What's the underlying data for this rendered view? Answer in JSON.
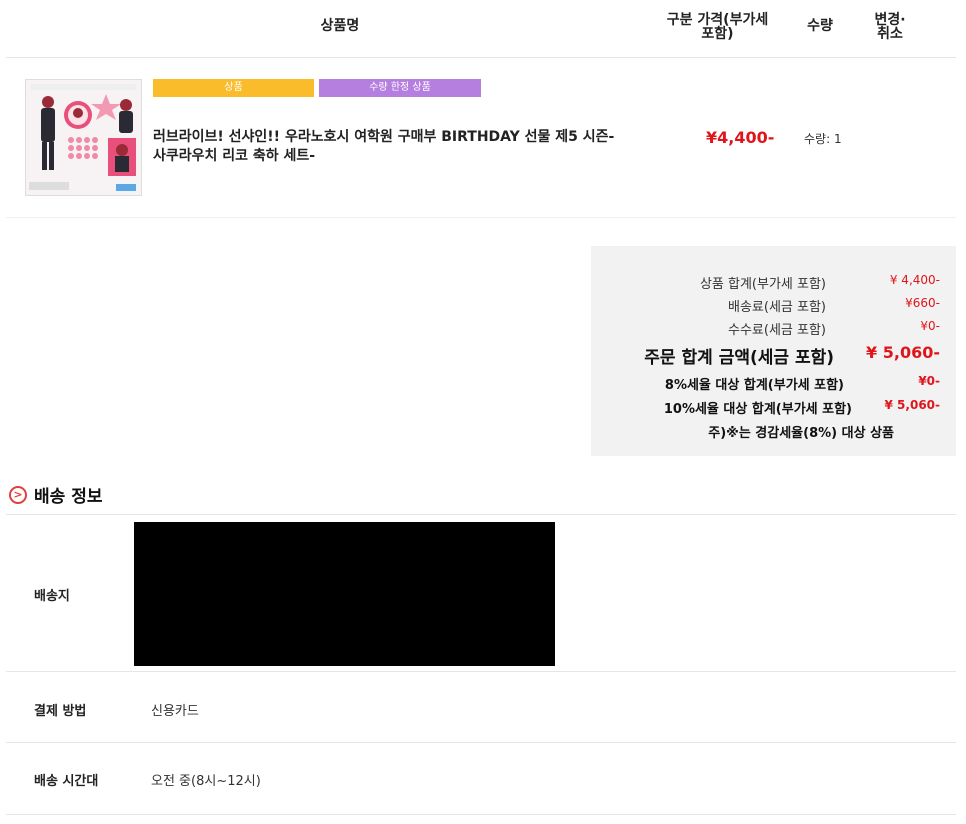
{
  "table_header": {
    "product_name": "상품명",
    "price_line1": "구분 가격(부가세",
    "price_line2": "포함)",
    "quantity": "수량",
    "change_line1": "변경·",
    "change_line2": "취소"
  },
  "item": {
    "badge_product": "상품",
    "badge_limited": "수량 한정 상품",
    "badge_product_color": "#fbbc2c",
    "badge_limited_color": "#b57fe0",
    "title_line1": "러브라이브! 선샤인!! 우라노호시 여학원 구매부 BIRTHDAY 선물 제5 시즌-",
    "title_line2": "사쿠라우치 리코 축하 세트-",
    "price": "¥4,400-",
    "quantity": "수량: 1"
  },
  "summary": {
    "rows": [
      {
        "label": "상품 합계(부가세 포함)",
        "value": "¥ 4,400-"
      },
      {
        "label": "배송료(세금 포함)",
        "value": "¥660-"
      },
      {
        "label": "수수료(세금 포함)",
        "value": "¥0-"
      }
    ],
    "total_label": "주문 합계 금액(세금 포함)",
    "total_value": "¥ 5,060-",
    "tax8_label": "8%세율 대상 합계(부가세 포함)",
    "tax8_value": "¥0-",
    "tax10_label": "10%세율 대상 합계(부가세 포함)",
    "tax10_value": "¥ 5,060-",
    "note": "주)※는 경감세율(8%) 대상 상품"
  },
  "shipping": {
    "section_title": "배송 정보",
    "address_label": "배송지",
    "payment_label": "결제 방법",
    "payment_value": "신용카드",
    "time_label": "배송 시간대",
    "time_value": "오전 중(8시~12시)"
  }
}
